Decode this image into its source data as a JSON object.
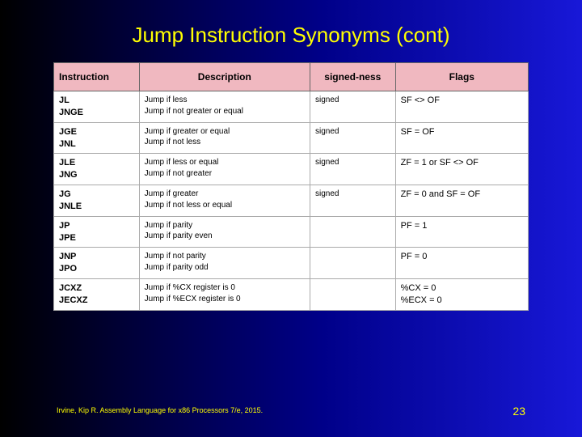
{
  "title": "Jump Instruction Synonyms (cont)",
  "headers": {
    "instruction": "Instruction",
    "description": "Description",
    "signedness": "signed-ness",
    "flags": "Flags"
  },
  "rows": [
    {
      "instr": "JL\nJNGE",
      "desc": "Jump if less\nJump if not greater or equal",
      "sign": "signed",
      "flags": "SF <> OF"
    },
    {
      "instr": "JGE\nJNL",
      "desc": "Jump if greater or equal\nJump if not less",
      "sign": "signed",
      "flags": "SF = OF"
    },
    {
      "instr": "JLE\nJNG",
      "desc": "Jump if less or equal\nJump if not greater",
      "sign": "signed",
      "flags": "ZF = 1 or SF <> OF"
    },
    {
      "instr": "JG\nJNLE",
      "desc": "Jump if greater\nJump if not less or equal",
      "sign": "signed",
      "flags": "ZF = 0 and SF = OF"
    },
    {
      "instr": "JP\nJPE",
      "desc": "Jump if parity\nJump if parity even",
      "sign": "",
      "flags": "PF = 1"
    },
    {
      "instr": "JNP\nJPO",
      "desc": "Jump if not parity\nJump if parity odd",
      "sign": "",
      "flags": "PF = 0"
    },
    {
      "instr": "JCXZ\nJECXZ",
      "desc": "Jump if %CX register is 0\nJump if %ECX register is 0",
      "sign": "",
      "flags": "%CX = 0\n%ECX = 0"
    }
  ],
  "footer": {
    "citation": "Irvine, Kip R. Assembly Language for x86 Processors 7/e, 2015.",
    "page": "23"
  },
  "chart_data": {
    "type": "table",
    "title": "Jump Instruction Synonyms (cont)",
    "columns": [
      "Instruction",
      "Description",
      "signed-ness",
      "Flags"
    ],
    "data": [
      [
        "JL / JNGE",
        "Jump if less / Jump if not greater or equal",
        "signed",
        "SF <> OF"
      ],
      [
        "JGE / JNL",
        "Jump if greater or equal / Jump if not less",
        "signed",
        "SF = OF"
      ],
      [
        "JLE / JNG",
        "Jump if less or equal / Jump if not greater",
        "signed",
        "ZF = 1 or SF <> OF"
      ],
      [
        "JG / JNLE",
        "Jump if greater / Jump if not less or equal",
        "signed",
        "ZF = 0 and SF = OF"
      ],
      [
        "JP / JPE",
        "Jump if parity / Jump if parity even",
        "",
        "PF = 1"
      ],
      [
        "JNP / JPO",
        "Jump if not parity / Jump if parity odd",
        "",
        "PF = 0"
      ],
      [
        "JCXZ / JECXZ",
        "Jump if %CX register is 0 / Jump if %ECX register is 0",
        "",
        "%CX = 0 / %ECX = 0"
      ]
    ]
  }
}
